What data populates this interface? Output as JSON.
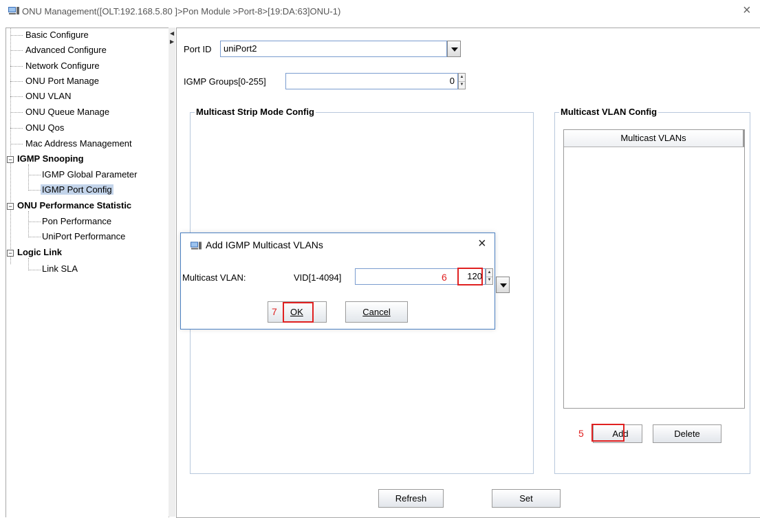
{
  "window": {
    "title": "ONU Management([OLT:192.168.5.80 ]>Pon Module >Port-8>[19:DA:63]ONU-1)",
    "close_glyph": "×"
  },
  "tree": {
    "items": [
      {
        "label": "Basic Configure"
      },
      {
        "label": "Advanced Configure"
      },
      {
        "label": "Network Configure"
      },
      {
        "label": "ONU Port Manage"
      },
      {
        "label": "ONU VLAN"
      },
      {
        "label": "ONU Queue Manage"
      },
      {
        "label": "ONU Qos"
      },
      {
        "label": "Mac Address Management"
      },
      {
        "label": "IGMP Snooping"
      },
      {
        "label": "IGMP Global Parameter"
      },
      {
        "label": "IGMP Port Config"
      },
      {
        "label": "ONU Performance Statistic"
      },
      {
        "label": "Pon Performance"
      },
      {
        "label": "UniPort Performance"
      },
      {
        "label": "Logic Link"
      },
      {
        "label": "Link SLA"
      }
    ],
    "expander_glyph": "−",
    "selected": "IGMP Port Config"
  },
  "form": {
    "port_id_label": "Port ID",
    "port_id_value": "uniPort2",
    "igmp_groups_label": "IGMP Groups[0-255]",
    "igmp_groups_value": "0",
    "strip_mode_title": "Multicast Strip Mode Config",
    "vlan_config_title": "Multicast VLAN Config",
    "vlan_table_header": "Multicast VLANs",
    "add_label": "Add",
    "delete_label": "Delete",
    "refresh_label": "Refresh",
    "set_label": "Set"
  },
  "dialog": {
    "title": "Add IGMP Multicast VLANs",
    "close_glyph": "×",
    "vlan_label": "Multicast VLAN:",
    "vid_label": "VID[1-4094]",
    "vid_value": "120",
    "ok_label": "OK",
    "cancel_label": "Cancel"
  },
  "annotations": {
    "step5": "5",
    "step6": "6",
    "step7": "7",
    "color": "#e02020"
  },
  "icons": {
    "window_icon": "computer-icon",
    "dialog_icon": "computer-icon"
  }
}
